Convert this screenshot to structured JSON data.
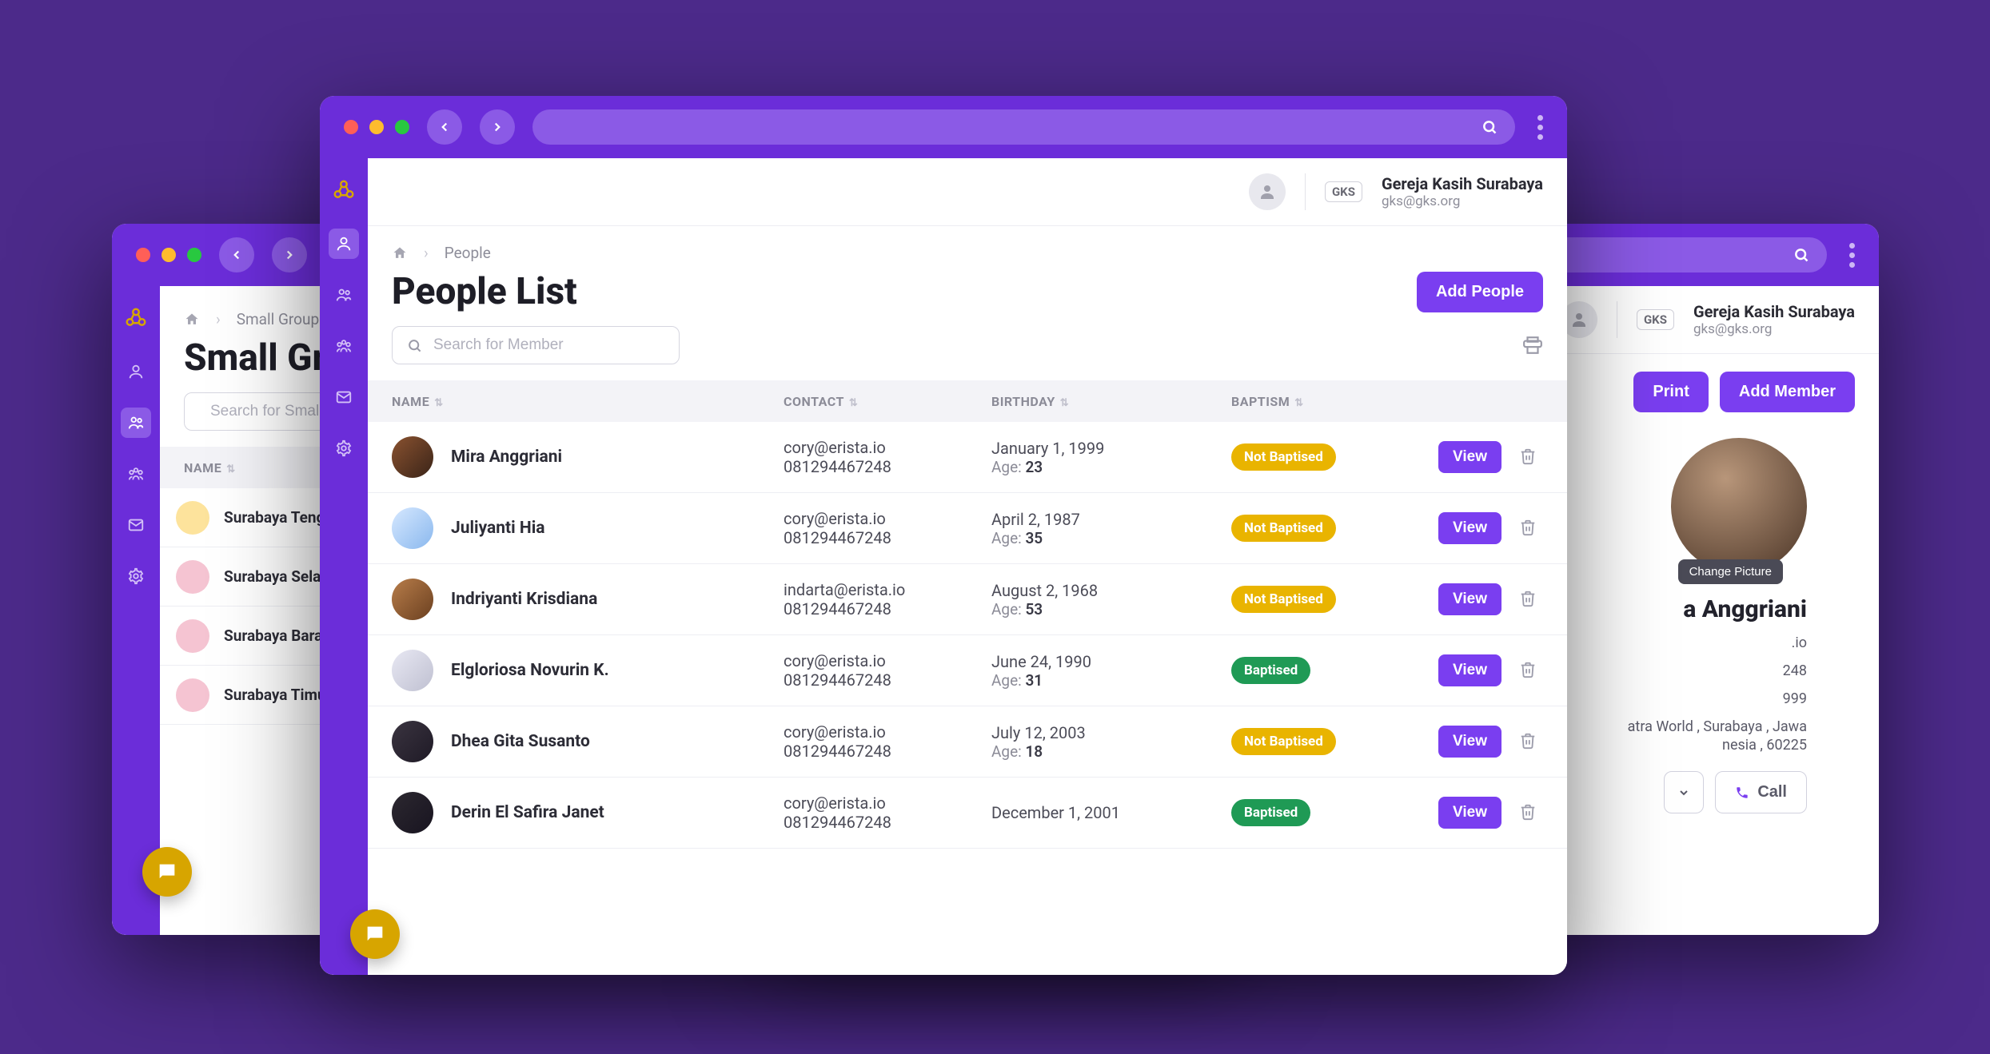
{
  "org": {
    "chip": "GKS",
    "name": "Gereja Kasih Surabaya",
    "email": "gks@gks.org"
  },
  "people_window": {
    "breadcrumb_current": "People",
    "title": "People List",
    "add_button": "Add People",
    "search_placeholder": "Search for Member",
    "columns": {
      "name": "NAME",
      "contact": "CONTACT",
      "birthday": "BIRTHDAY",
      "baptism": "BAPTISM"
    },
    "age_label": "Age:",
    "view_label": "View",
    "baptism_labels": {
      "baptised": "Baptised",
      "not_baptised": "Not Baptised"
    },
    "rows": [
      {
        "name": "Mira Anggriani",
        "email": "cory@erista.io",
        "phone": "081294467248",
        "birthday": "January 1, 1999",
        "age": "23",
        "baptised": false
      },
      {
        "name": "Juliyanti Hia",
        "email": "cory@erista.io",
        "phone": "081294467248",
        "birthday": "April 2, 1987",
        "age": "35",
        "baptised": false
      },
      {
        "name": "Indriyanti Krisdiana",
        "email": "indarta@erista.io",
        "phone": "081294467248",
        "birthday": "August 2, 1968",
        "age": "53",
        "baptised": false
      },
      {
        "name": "Elgloriosa Novurin K.",
        "email": "cory@erista.io",
        "phone": "081294467248",
        "birthday": "June 24, 1990",
        "age": "31",
        "baptised": true
      },
      {
        "name": "Dhea Gita Susanto",
        "email": "cory@erista.io",
        "phone": "081294467248",
        "birthday": "July 12, 2003",
        "age": "18",
        "baptised": false
      },
      {
        "name": "Derin El Safira Janet",
        "email": "cory@erista.io",
        "phone": "081294467248",
        "birthday": "December 1, 2001",
        "age": "",
        "baptised": true
      }
    ]
  },
  "smallgroup_window": {
    "breadcrumb_current": "Small Group",
    "title": "Small Gro",
    "search_placeholder": "Search for Small Gro",
    "column_name": "NAME",
    "items": [
      {
        "label": "Surabaya Tengah"
      },
      {
        "label": "Surabaya Selatan"
      },
      {
        "label": "Surabaya Barat S"
      },
      {
        "label": "Surabaya Timur S"
      }
    ]
  },
  "profile_window": {
    "print_button": "Print",
    "add_member_button": "Add Member",
    "change_picture": "Change Picture",
    "name_suffix": "a Anggriani",
    "line1": ".io",
    "line2": "248",
    "line3": "999",
    "line4a": "atra World , Surabaya , Jawa",
    "line4b": "nesia , 60225",
    "call_button": "Call"
  }
}
